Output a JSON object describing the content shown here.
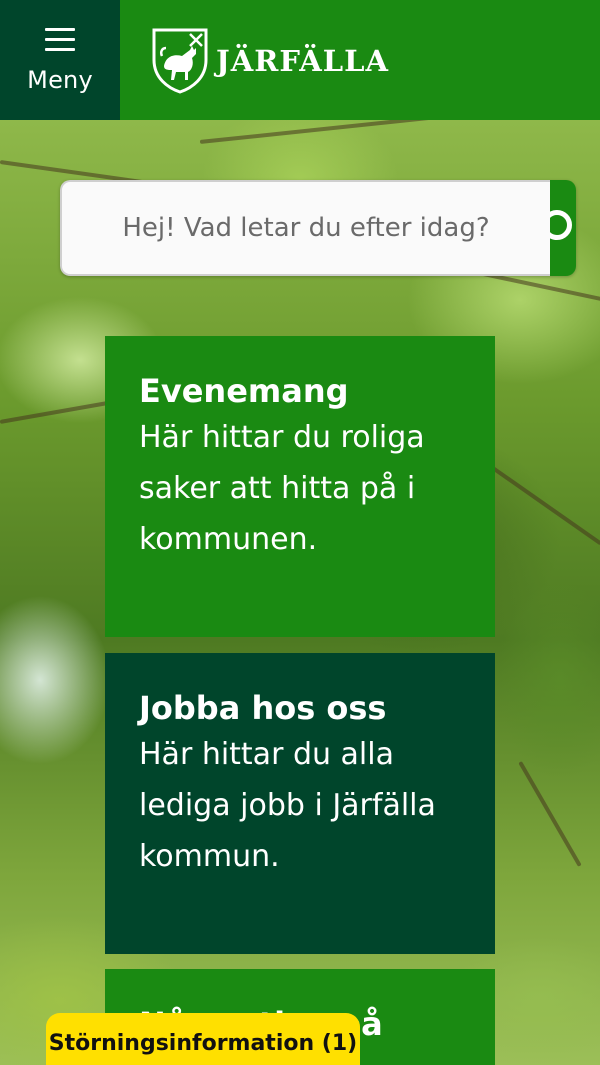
{
  "header": {
    "menu_label": "Meny",
    "logo_text": "JÄRFÄLLA"
  },
  "search": {
    "placeholder": "Hej! Vad letar du efter idag?"
  },
  "cards": [
    {
      "title": "Evenemang",
      "text": "Här hittar du roliga saker att hitta på i kommunen.",
      "color": "#1a8a12"
    },
    {
      "title": "Jobba hos oss",
      "text": "Här hittar du alla lediga jobb i Järfälla kommun.",
      "color": "#00452b"
    },
    {
      "title": "Några tips på grupper",
      "color": "#1a8a12"
    }
  ],
  "disruption": {
    "label": "Störningsinformation (1)"
  },
  "colors": {
    "brand_green": "#1a8a12",
    "dark_green": "#00452b",
    "alert_yellow": "#ffe000"
  },
  "icons": {
    "menu": "hamburger-icon",
    "search": "search-icon",
    "logo": "coat-of-arms-icon"
  }
}
